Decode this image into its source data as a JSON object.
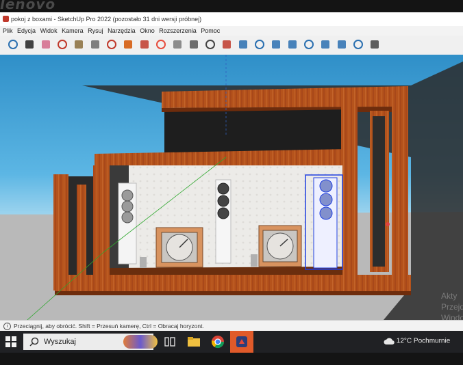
{
  "bezel": {
    "brand": "lenovo"
  },
  "window": {
    "title": "pokoj z boxami - SketchUp Pro 2022 (pozostało 31 dni wersji próbnej)"
  },
  "menu": {
    "items": [
      {
        "label": "Plik"
      },
      {
        "label": "Edycja"
      },
      {
        "label": "Widok"
      },
      {
        "label": "Kamera"
      },
      {
        "label": "Rysuj"
      },
      {
        "label": "Narzędzia"
      },
      {
        "label": "Okno"
      },
      {
        "label": "Rozszerzenia"
      },
      {
        "label": "Pomoc"
      }
    ]
  },
  "toolbar": {
    "tools": [
      {
        "icon": "zoom-icon",
        "color": "#2a6fb0"
      },
      {
        "icon": "select-arrow-icon",
        "color": "#222222"
      },
      {
        "icon": "eraser-icon",
        "color": "#d46a8a"
      },
      {
        "icon": "pencil-icon",
        "color": "#c0392b"
      },
      {
        "icon": "shape-icon",
        "color": "#8a6d3b"
      },
      {
        "icon": "pushpull-icon",
        "color": "#6b6b6b"
      },
      {
        "icon": "offset-icon",
        "color": "#c0392b"
      },
      {
        "icon": "rotate-icon",
        "color": "#d35400"
      },
      {
        "icon": "move-icon",
        "color": "#c0392b"
      },
      {
        "icon": "orbit-icon",
        "color": "#e74c3c"
      },
      {
        "icon": "follow-me-icon",
        "color": "#7a7a7a"
      },
      {
        "icon": "tape-icon",
        "color": "#555555"
      },
      {
        "icon": "text-icon",
        "color": "#444444"
      },
      {
        "icon": "paint-bucket-icon",
        "color": "#c0392b"
      },
      {
        "icon": "orbit-view-icon",
        "color": "#2a6fb0"
      },
      {
        "icon": "pan-icon",
        "color": "#2a6fb0"
      },
      {
        "icon": "zoom-view-icon",
        "color": "#2a6fb0"
      },
      {
        "icon": "zoom-extents-icon",
        "color": "#2a6fb0"
      },
      {
        "icon": "warehouse-icon",
        "color": "#2a6fb0"
      },
      {
        "icon": "extension-icon",
        "color": "#2a6fb0"
      },
      {
        "icon": "layout-icon",
        "color": "#2a6fb0"
      },
      {
        "icon": "style-builder-icon",
        "color": "#2a6fb0"
      },
      {
        "icon": "account-icon",
        "color": "#444444"
      }
    ]
  },
  "status": {
    "message": "Przeciągnij, aby obrócić. Shift = Przesuń kamerę, Ctrl = Obracaj horyzont."
  },
  "taskbar": {
    "search_label": "Wyszukaj",
    "apps": [
      {
        "icon": "task-view-icon"
      },
      {
        "icon": "file-explorer-icon"
      },
      {
        "icon": "chrome-icon"
      },
      {
        "icon": "sketchup-icon"
      }
    ],
    "temperature": "12°C",
    "weather": "Pochmurnie"
  },
  "watermark": {
    "line1": "Akty",
    "line2": "Przejd",
    "line3": "Windo"
  },
  "colors": {
    "wood": "#b5531c",
    "wood_dark": "#8c3a12",
    "wall": "#e8e6e3",
    "selection": "#1f3fe0"
  }
}
